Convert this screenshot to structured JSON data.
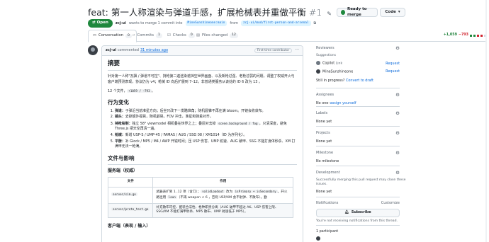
{
  "header": {
    "title": "feat: 第一人称渲染与弹道手感，扩展枪械表并重做平衡",
    "number": "#1",
    "ready_label": "Ready to merge",
    "code_label": "Code",
    "open_label": "Open",
    "author": "zcj-ui",
    "merge_text": "wants to merge 1 commit into",
    "base_branch": "MineSunshineone:main",
    "from_text": "from",
    "head_branch": "zcj-ui/mod/first-person-and-arsenal"
  },
  "tabs": [
    {
      "label": "Conversation",
      "count": "0"
    },
    {
      "label": "Commits",
      "count": "1"
    },
    {
      "label": "Checks",
      "count": "0"
    },
    {
      "label": "Files changed",
      "count": "12"
    }
  ],
  "diffstat": {
    "added": "+1,059",
    "removed": "−793"
  },
  "comment": {
    "author": "zcj-ui",
    "action": "commented",
    "time": "31 minutes ago",
    "badge": "First-time contributor",
    "summary_heading": "摘要",
    "summary_p1": "针对第一人称\"瓦飘 / 弹道不可控\"、持枪第二遍渲染遮挡空世界画面、以及新枪过强、老枪过弱的问题，调整了权威开火与客户端预测表现，协议仍为 v4；枪械 ID 向后扩展到 7–12，非普通类服务从该处的 ID 6 改为 13 。",
    "summary_p2": "12 个文件，",
    "summary_diff": "+1059 / −793",
    "changes_heading": "行为变化",
    "changes": [
      {
        "bold": "弹道：",
        "text": "子弹沿当前准星方向；后坐只改下一发瞄准角；随机圆锥不再在满 bloom。开镜会收敛布。"
      },
      {
        "bold": "镜头：",
        "text": "去掉额外视晃，随机颤晃，FOV 冲击，准星和弹着对齐。"
      },
      {
        "bold": "持枪绘制：",
        "text": "独立 58° viewmodel 相机叠在世界之上；叠层对去掉 ",
        "mono1": "scene.background / fog",
        "tail": "，只清深度，避免 Three.js 把天空再清一遍。"
      },
      {
        "bold": "枪械：",
        "text": "新增 USP-S / UMP-45 / FAMAS / AUG / SSG 08 / XM1014（ID 为序列化）。"
      },
      {
        "bold": "平衡：",
        "text": "补 Glock / MP5 / M4 / AWP 开镜时间；压 USP 伤害、UMP 射速、AUG 破甲、SSG 不能打身体秒杀、XM 打满甲无法一枪满。"
      }
    ],
    "files_heading": "文件与影响",
    "server_heading": "服务端（权威）",
    "client_heading": "客户端（表现 / 输入）",
    "table": {
      "col_file": "文件",
      "col_effect": "作用",
      "rows": [
        {
          "file": "server/sim.go",
          "pre": "武器表扩到 1..12 项（含刀）；",
          "code1": "validLoadout",
          "mid": " 改为 ",
          "code2": "isPrimary + isSecondary",
          "post": "。开火路径用 ",
          "code3": "loun",
          "post2": "（不再 weapon < 6 ，否则 USP/XM 会不射弹、不散布）。勤"
        },
        {
          "file": "server/proto_test.go",
          "pre": "补充散布可控、配装合法性、枪种职责分离（AUG 破甲不超过 AK、USP 伤害上限、SSG/XM 不能打满甲秒杀、MP5 散布、UMP 射速低于 MP5）。",
          "code1": "",
          "mid": "",
          "code2": "",
          "post": "",
          "code3": "",
          "post2": ""
        }
      ]
    }
  },
  "sidebar": {
    "reviewers_title": "Reviewers",
    "suggestions": "Suggestions",
    "copilot": "Copilot",
    "copilot_tag": "Link",
    "request1": "Request",
    "suggested_user": "MineSunshineone",
    "request2": "Request",
    "still_progress": "Still in progress?",
    "convert_draft": "Convert to draft",
    "assignees_title": "Assignees",
    "assignees_value": "No one–",
    "assign_yourself": "assign yourself",
    "labels_title": "Labels",
    "labels_value": "None yet",
    "projects_title": "Projects",
    "projects_value": "None yet",
    "milestone_title": "Milestone",
    "milestone_value": "No milestone",
    "development_title": "Development",
    "development_text1": "Successfully merging this pull request may close these",
    "development_text2": "issues.",
    "development_value": "None yet",
    "notifications_title": "Notifications",
    "customize": "Customize",
    "subscribe": "Subscribe",
    "not_receiving": "You're not receiving notifications from this thread.",
    "participants": "1 participant"
  }
}
